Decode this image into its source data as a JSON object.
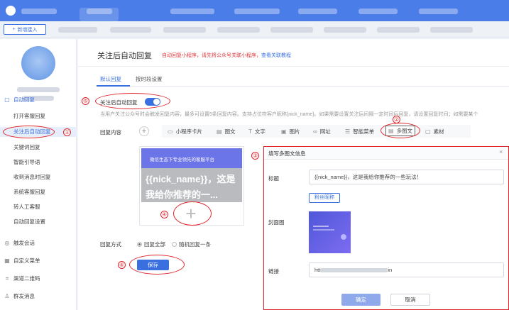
{
  "topbar": {
    "icon": "logo-icon"
  },
  "tabbar": {
    "add_label": "新增接入",
    "add_icon": "plus-icon"
  },
  "sidebar": {
    "items": [
      {
        "label": "自动回复",
        "icon": "chat-bubble-icon"
      },
      {
        "label": "打开客服回复"
      },
      {
        "label": "关注后自动回复"
      },
      {
        "label": "关键词回复"
      },
      {
        "label": "智能引导语"
      },
      {
        "label": "收到消息时回复"
      },
      {
        "label": "系统客服回复"
      },
      {
        "label": "转人工客服"
      },
      {
        "label": "自动回复设置"
      },
      {
        "label": "触发会话",
        "icon": "headset-icon"
      },
      {
        "label": "自定义菜单",
        "icon": "grid-icon"
      },
      {
        "label": "渠道二维码",
        "icon": "qrcode-icon"
      },
      {
        "label": "群发消息",
        "icon": "people-icon"
      }
    ]
  },
  "page": {
    "title": "关注后自动回复",
    "note": "自动回复小程序，请先将公众号关联小程序，",
    "note_link": "查看关联教程"
  },
  "tabs": [
    {
      "label": "默认回复"
    },
    {
      "label": "按时段设置"
    }
  ],
  "toggle": {
    "label": "关注后自动回复",
    "on": true
  },
  "description": "当用户关注公众号时会触发回复内容，最多可设置5条回复内容。支持占位符客户昵称{nick_name}。如果需要设置关注后间隔一定时间后回复，请设置回复时间；如需要某个",
  "reply": {
    "label": "回复内容",
    "tools": [
      {
        "label": "小程序卡片",
        "icon": "miniprogram-icon"
      },
      {
        "label": "图文",
        "icon": "article-icon"
      },
      {
        "label": "文字",
        "icon": "text-icon"
      },
      {
        "label": "图片",
        "icon": "image-icon"
      },
      {
        "label": "网址",
        "icon": "link-icon"
      },
      {
        "label": "智能菜单",
        "icon": "menu-icon"
      },
      {
        "label": "多图文",
        "icon": "multi-article-icon"
      },
      {
        "label": "素材",
        "icon": "material-icon"
      }
    ],
    "preview": {
      "banner": "微信生态下专业领先的客服平台",
      "text": "{{nick_name}}，这是我给你推荐的一..."
    }
  },
  "reply_mode": {
    "label": "回复方式",
    "options": [
      {
        "label": "回复全部",
        "checked": true
      },
      {
        "label": "随机回复一条",
        "checked": false
      }
    ]
  },
  "save_label": "保存",
  "dialog": {
    "title": "填写多图文信息",
    "close": "×",
    "title_label": "标题",
    "title_value": "{{nick_name}}，这是我给你推荐的一些玩法！",
    "nick_button": "粉丝昵称",
    "cover_label": "封面图",
    "link_label": "链接",
    "link_prefix": "htt",
    "link_suffix": "in",
    "ok": "确定",
    "cancel": "取消"
  },
  "annotations": [
    "①",
    "②",
    "③",
    "④",
    "⑤",
    "⑥"
  ],
  "colors": {
    "primary": "#3a6fe0",
    "annotation": "#e0252b",
    "topbar": "#4a7de8"
  }
}
